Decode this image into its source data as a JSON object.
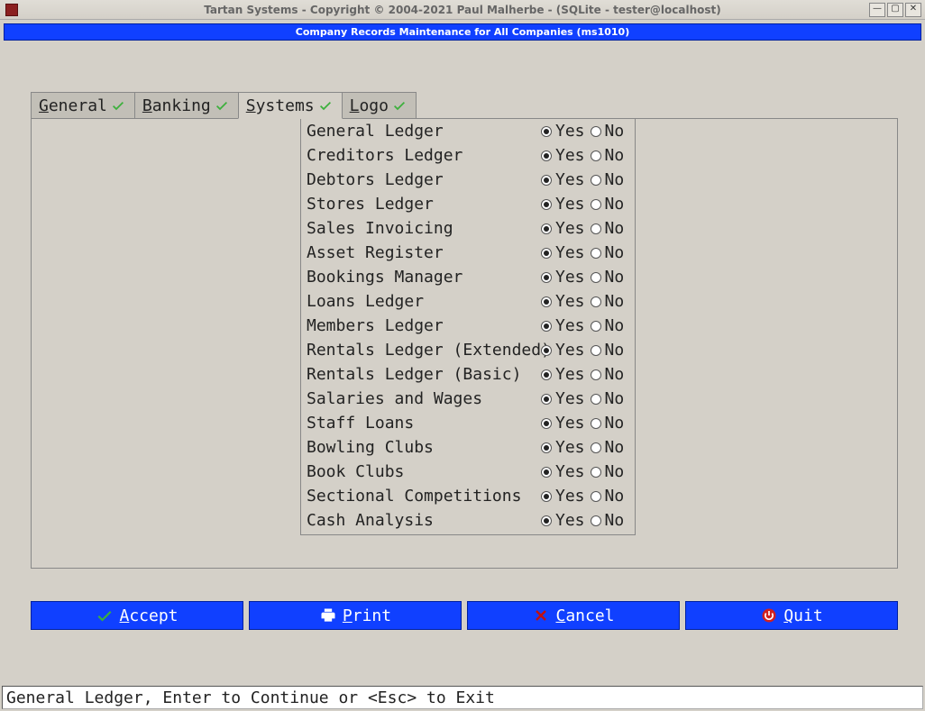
{
  "window": {
    "title": "Tartan Systems - Copyright © 2004-2021 Paul Malherbe - (SQLite - tester@localhost)"
  },
  "header": {
    "title": "Company Records Maintenance for All Companies (ms1010)"
  },
  "tabs": [
    {
      "label": "General",
      "accel": "G",
      "checked": true,
      "active": false
    },
    {
      "label": "Banking",
      "accel": "B",
      "checked": true,
      "active": false
    },
    {
      "label": "Systems",
      "accel": "S",
      "checked": true,
      "active": true
    },
    {
      "label": "Logo",
      "accel": "L",
      "checked": true,
      "active": false
    }
  ],
  "radio_labels": {
    "yes": "Yes",
    "no": "No"
  },
  "systems": [
    {
      "label": "General Ledger",
      "value": "yes"
    },
    {
      "label": "Creditors Ledger",
      "value": "yes"
    },
    {
      "label": "Debtors Ledger",
      "value": "yes"
    },
    {
      "label": "Stores Ledger",
      "value": "yes"
    },
    {
      "label": "Sales Invoicing",
      "value": "yes"
    },
    {
      "label": "Asset Register",
      "value": "yes"
    },
    {
      "label": "Bookings Manager",
      "value": "yes"
    },
    {
      "label": "Loans Ledger",
      "value": "yes"
    },
    {
      "label": "Members Ledger",
      "value": "yes"
    },
    {
      "label": "Rentals Ledger (Extended)",
      "value": "yes"
    },
    {
      "label": "Rentals Ledger (Basic)",
      "value": "yes"
    },
    {
      "label": "Salaries and Wages",
      "value": "yes"
    },
    {
      "label": "Staff Loans",
      "value": "yes"
    },
    {
      "label": "Bowling Clubs",
      "value": "yes"
    },
    {
      "label": "Book Clubs",
      "value": "yes"
    },
    {
      "label": "Sectional Competitions",
      "value": "yes"
    },
    {
      "label": "Cash Analysis",
      "value": "yes"
    }
  ],
  "buttons": {
    "accept": "Accept",
    "print": "Print",
    "cancel": "Cancel",
    "quit": "Quit"
  },
  "status": "General Ledger, Enter to Continue or <Esc> to Exit"
}
